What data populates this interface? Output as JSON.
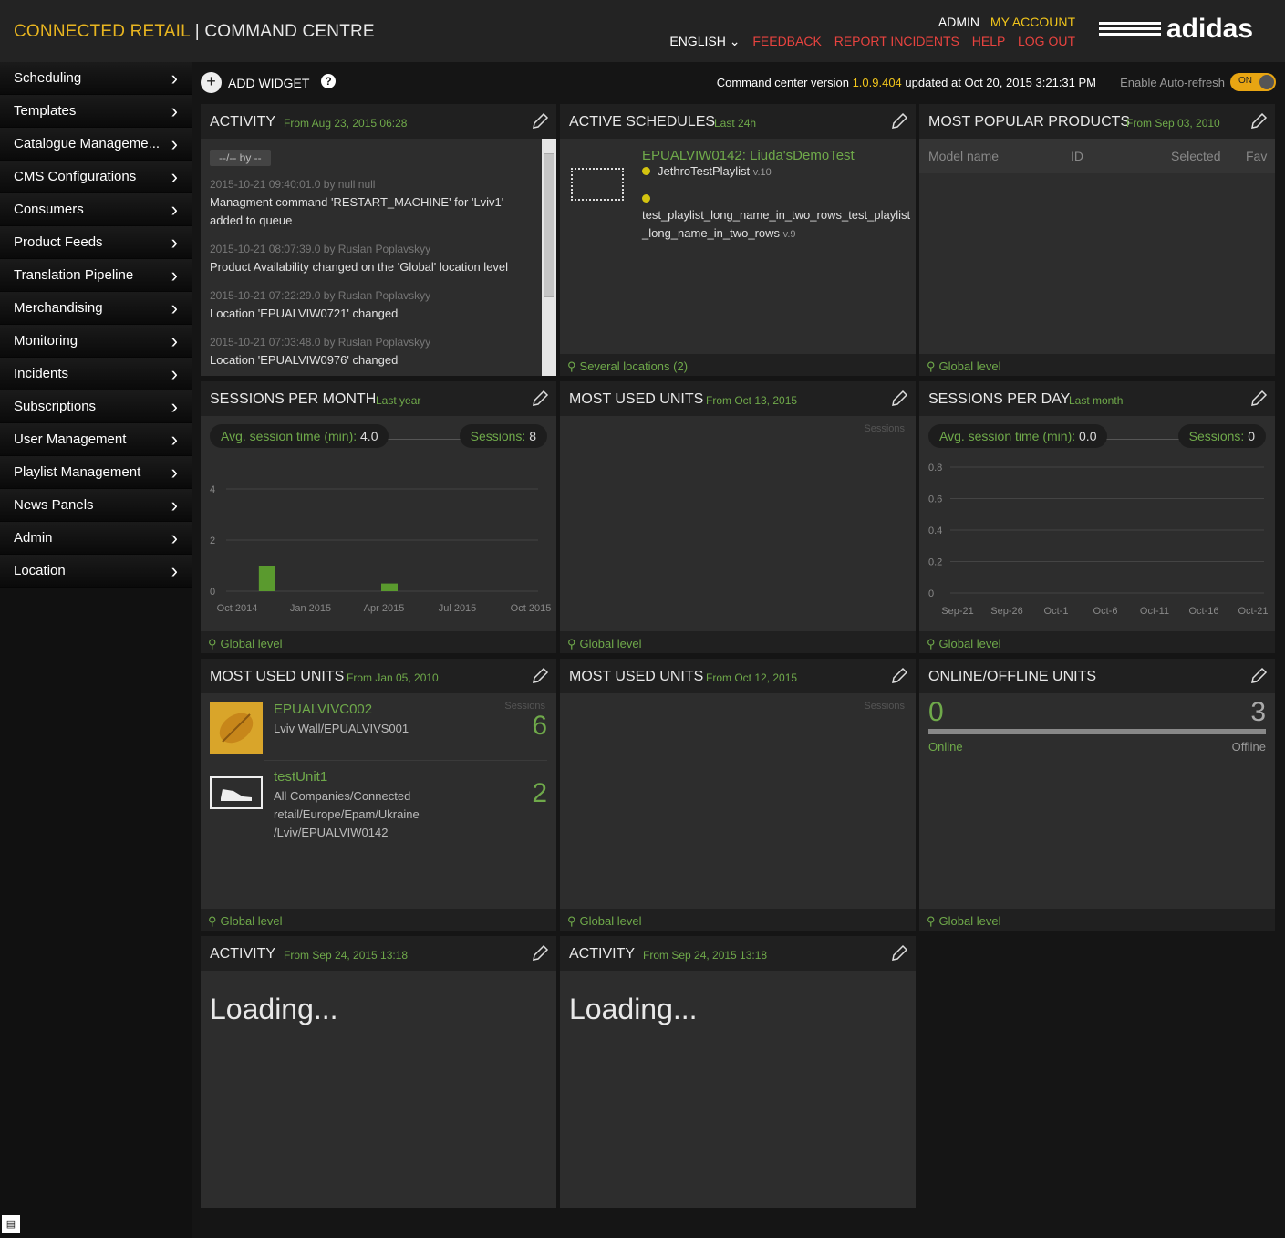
{
  "header": {
    "brand_primary": "CONNECTED RETAIL",
    "brand_sep": "|",
    "brand_secondary": "COMMAND CENTRE",
    "admin": "ADMIN",
    "my_account": "MY ACCOUNT",
    "language": "ENGLISH",
    "feedback": "FEEDBACK",
    "report_incidents": "REPORT INCIDENTS",
    "help": "HELP",
    "logout": "LOG OUT",
    "logo_text": "adidas"
  },
  "sidebar": {
    "items": [
      {
        "label": "Scheduling"
      },
      {
        "label": "Templates"
      },
      {
        "label": "Catalogue Manageme..."
      },
      {
        "label": "CMS Configurations"
      },
      {
        "label": "Consumers"
      },
      {
        "label": "Product Feeds"
      },
      {
        "label": "Translation Pipeline"
      },
      {
        "label": "Merchandising"
      },
      {
        "label": "Monitoring"
      },
      {
        "label": "Incidents"
      },
      {
        "label": "Subscriptions"
      },
      {
        "label": "User Management"
      },
      {
        "label": "Playlist Management"
      },
      {
        "label": "News Panels"
      },
      {
        "label": "Admin"
      },
      {
        "label": "Location"
      }
    ]
  },
  "toolbar": {
    "add_widget": "ADD WIDGET",
    "help": "?",
    "version_prefix": "Command center version",
    "version": "1.0.9.404",
    "version_suffix": "updated at Oct 20, 2015 3:21:31 PM",
    "autorefresh_label": "Enable Auto-refresh",
    "autorefresh_state": "ON"
  },
  "widgets": {
    "activity1": {
      "title": "ACTIVITY",
      "subtitle": "From Aug 23, 2015 06:28",
      "filter": "--/-- by --",
      "items": [
        {
          "meta": "2015-10-21 09:40:01.0 by null null",
          "text": "Managment command 'RESTART_MACHINE' for 'Lviv1' added to queue"
        },
        {
          "meta": "2015-10-21 08:07:39.0 by Ruslan Poplavskyy",
          "text": "Product Availability changed on the 'Global' location level"
        },
        {
          "meta": "2015-10-21 07:22:29.0 by Ruslan Poplavskyy",
          "text": "Location 'EPUALVIW0721' changed"
        },
        {
          "meta": "2015-10-21 07:03:48.0 by Ruslan Poplavskyy",
          "text": "Location 'EPUALVIW0976' changed"
        }
      ]
    },
    "schedules": {
      "title": "ACTIVE SCHEDULES",
      "subtitle": "Last 24h",
      "name": "EPUALVIW0142: Liuda'sDemoTest",
      "playlist1": "JethroTestPlaylist",
      "playlist1_ver": "v.10",
      "playlist2": "test_playlist_long_name_in_two_rows_test_playlist _long_name_in_two_rows",
      "playlist2_ver": "v.9",
      "footer": "Several locations (2)"
    },
    "popular": {
      "title": "MOST POPULAR PRODUCTS",
      "subtitle": "From Sep 03, 2010",
      "columns": [
        "Model name",
        "ID",
        "Selected",
        "Fav"
      ],
      "footer": "Global level"
    },
    "sessions_month": {
      "title": "SESSIONS PER MONTH",
      "subtitle": "Last year",
      "avg_label": "Avg. session time (min):",
      "avg_value": "4.0",
      "sessions_label": "Sessions:",
      "sessions_value": "8",
      "footer": "Global level"
    },
    "used_units1": {
      "title": "MOST USED UNITS",
      "subtitle": "From Oct 13, 2015",
      "col": "Sessions",
      "footer": "Global level"
    },
    "sessions_day": {
      "title": "SESSIONS PER DAY",
      "subtitle": "Last month",
      "avg_label": "Avg. session time (min):",
      "avg_value": "0.0",
      "sessions_label": "Sessions:",
      "sessions_value": "0",
      "footer": "Global level"
    },
    "used_units2": {
      "title": "MOST USED UNITS",
      "subtitle": "From Jan 05, 2010",
      "col": "Sessions",
      "units": [
        {
          "name": "EPUALVIVC002",
          "path": "Lviv Wall/EPUALVIVS001",
          "count": "6"
        },
        {
          "name": "testUnit1",
          "path": "All Companies/Connected retail/Europe/Epam/Ukraine /Lviv/EPUALVIW0142",
          "count": "2"
        }
      ],
      "footer": "Global level"
    },
    "used_units3": {
      "title": "MOST USED UNITS",
      "subtitle": "From Oct 12, 2015",
      "col": "Sessions",
      "footer": "Global level"
    },
    "online": {
      "title": "ONLINE/OFFLINE UNITS",
      "online_count": "0",
      "offline_count": "3",
      "online_label": "Online",
      "offline_label": "Offline",
      "online_fraction": 0,
      "footer": "Global level"
    },
    "activity2": {
      "title": "ACTIVITY",
      "subtitle": "From Sep 24, 2015 13:18",
      "loading": "Loading..."
    },
    "activity3": {
      "title": "ACTIVITY",
      "subtitle": "From Sep 24, 2015 13:18",
      "loading": "Loading..."
    }
  },
  "chart_data": [
    {
      "type": "bar",
      "title": "SESSIONS PER MONTH",
      "x_tick_labels": [
        "Oct 2014",
        "Jan 2015",
        "Apr 2015",
        "Jul 2015",
        "Oct 2015"
      ],
      "y_ticks": [
        0,
        2,
        4
      ],
      "ylim": [
        0,
        4
      ],
      "series": [
        {
          "values": [
            {
              "x": "Nov 2014",
              "y": 1
            },
            {
              "x": "Apr 2015",
              "y": 0.3
            }
          ]
        }
      ],
      "colors": {
        "bar": "#5a9a2e"
      },
      "grid": true
    },
    {
      "type": "line",
      "title": "SESSIONS PER DAY",
      "x_tick_labels": [
        "Sep-21",
        "Sep-26",
        "Oct-1",
        "Oct-6",
        "Oct-11",
        "Oct-16",
        "Oct-21"
      ],
      "y_ticks": [
        0,
        0.2,
        0.4,
        0.6,
        0.8
      ],
      "ylim": [
        0,
        0.8
      ],
      "series": [],
      "grid": true
    }
  ]
}
